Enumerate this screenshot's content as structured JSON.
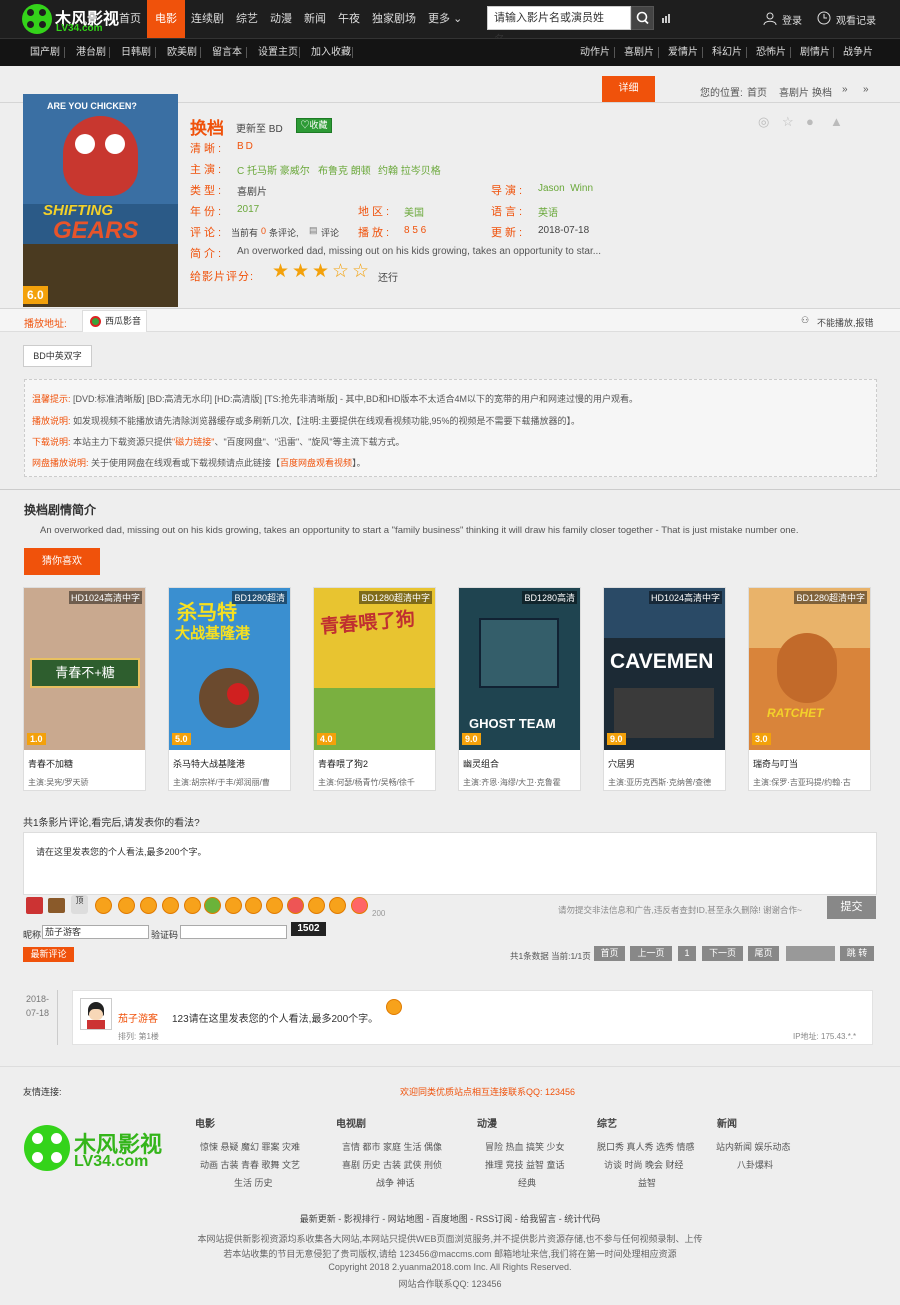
{
  "header": {
    "logo_text": "木风影视",
    "logo_url": "LV34.com",
    "nav": [
      "首页",
      "电影",
      "连续剧",
      "综艺",
      "动漫",
      "新闻",
      "午夜",
      "独家剧场",
      "更多"
    ],
    "search_placeholder": "请输入影片名或演员姓名。",
    "login": "登录",
    "history": "观看记录"
  },
  "subnav": {
    "left": [
      "国产剧",
      "港台剧",
      "日韩剧",
      "欧美剧",
      "留言本",
      "设置主页",
      "加入收藏"
    ],
    "right": [
      "动作片",
      "喜剧片",
      "爱情片",
      "科幻片",
      "恐怖片",
      "剧情片",
      "战争片"
    ]
  },
  "crumb": {
    "detail_btn": "详细",
    "location": "您的位置:",
    "home": "首页",
    "cat": "喜剧片",
    "title": "换档",
    "arrow1": "»",
    "arrow2": "»"
  },
  "movie": {
    "poster_top": "ARE YOU CHICKEN?",
    "poster_title1": "SHIFTING",
    "poster_title2": "GEARS",
    "score": "6.0",
    "title": "换档",
    "update": "更新至 BD",
    "fav": "收藏",
    "clarity_label": "清晰:",
    "clarity": "BD",
    "actors_label": "主演:",
    "actors": [
      "C 托马斯 豪威尔",
      "布鲁克 朗顿",
      "约翰 拉岑贝格"
    ],
    "type_label": "类型:",
    "type": "喜剧片",
    "director_label": "导演:",
    "director": "Jason  Winn",
    "year_label": "年份:",
    "year": "2017",
    "area_label": "地区:",
    "area": "美国",
    "lang_label": "语言:",
    "lang": "英语",
    "comment_label": "评论:",
    "comment_pre": "当前有",
    "comment_count": "0",
    "comment_post": "条评论,",
    "comment_link": "评论",
    "play_label": "播放:",
    "play_count": "8 5 6",
    "date_label": "更新:",
    "date": "2018-07-18",
    "intro_label": "简介:",
    "intro": "An overworked dad, missing out on his kids growing, takes an opportunity to star...",
    "rate_label": "给影片评分:",
    "rating": 3,
    "rate_text": "还行"
  },
  "play": {
    "label": "播放地址:",
    "source": "西瓜影音",
    "report": "不能播放,报错",
    "episode": "BD中英双字"
  },
  "notice": {
    "l1_label": "温馨提示:",
    "l1": "[DVD:标准清晰版] [BD:高清无水印] [HD:高清版] [TS:抢先非清晰版] - 其中,BD和HD版本不太适合4M以下的宽带的用户和网速过慢的用户观看。",
    "l2_label": "播放说明:",
    "l2": "如发现视频不能播放请先清除浏览器缓存或多刷新几次,【注明:主要提供在线观看视频功能,95%的视频是不需要下载播放器的】。",
    "l3_label": "下载说明:",
    "l3a": "本站主力下载资源只提供",
    "l3b": "\"磁力链接\"",
    "l3c": "、\"百度网盘\"、\"迅雷\"、\"旋风\"等主流下载方式。",
    "l4_label": "网盘播放说明:",
    "l4a": "关于使用网盘在线观看或下载视频请点此链接【",
    "l4b": "百度网盘观看视频",
    "l4c": "】。"
  },
  "synopsis": {
    "title": "换档剧情简介",
    "text": "An overworked dad, missing out on his kids growing, takes an opportunity to start a \"family business\" thinking it will draw his family closer together - That is just mistake number one."
  },
  "guess": {
    "label": "猜你喜欢",
    "items": [
      {
        "name": "青春不加糖",
        "actors": "主演:吴宪/罗天骄",
        "q": "HD1024高清中字",
        "score": "1.0",
        "color": "#c9a98f"
      },
      {
        "name": "杀马特大战基隆港",
        "actors": "主演:胡宗祥/于丰/郑润丽/曹",
        "q": "BD1280超清",
        "score": "5.0",
        "color": "#3a8fd0"
      },
      {
        "name": "青春喂了狗2",
        "actors": "主演:何瑟/杨青竹/吴畅/徐千",
        "q": "BD1280超清中字",
        "score": "4.0",
        "color": "#e8c430"
      },
      {
        "name": "幽灵组合",
        "actors": "主演:齐恩·海缪/大卫·克鲁霍",
        "q": "BD1280高清",
        "score": "9.0",
        "color": "#1f4450"
      },
      {
        "name": "穴居男",
        "actors": "主演:亚历克西斯·克纳普/查德",
        "q": "HD1024高清中字",
        "score": "9.0",
        "color": "#1c2a35"
      },
      {
        "name": "瑞奇与叮当",
        "actors": "主演:保罗·吉亚玛提/约翰·古",
        "q": "BD1280超清中字",
        "score": "3.0",
        "color": "#d9843a"
      }
    ]
  },
  "comment": {
    "title": "共1条影片评论,看完后,请发表你的看法?",
    "placeholder": "请在这里发表您的个人看法,最多200个字。",
    "count": "200",
    "warn": "请勿提交非法信息和广告,违反者查封ID,甚至永久删除! 谢谢合作~",
    "submit": "提交",
    "nick_label": "昵称",
    "nick": "茄子游客",
    "code_label": "验证码",
    "code": "1502",
    "latest": "最新评论",
    "pager_info": "共1条数据 当前:1/1页",
    "pages": [
      "首页",
      "上一页",
      "1",
      "下一页",
      "尾页"
    ],
    "jump": "跳 转",
    "item": {
      "date1": "2018-",
      "date2": "07-18",
      "user": "茄子游客",
      "text": "123请在这里发表您的个人看法,最多200个字。",
      "ip": "IP地址: 175.43.*.*",
      "rank": "排列: 第1楼"
    }
  },
  "footer": {
    "links_label": "友情连接:",
    "links_ad": "欢迎同类优质站点相互连接联系QQ: 123456",
    "cols": [
      {
        "title": "电影",
        "rows": [
          "惊悚 悬疑 魔幻 罪案 灾难",
          "动画 古装 青春 歌舞 文艺",
          "生活 历史"
        ]
      },
      {
        "title": "电视剧",
        "rows": [
          "言情 都市 家庭 生活 偶像",
          "喜剧 历史 古装 武侠 刑侦",
          "战争 神话"
        ]
      },
      {
        "title": "动漫",
        "rows": [
          "冒险 热血 搞笑 少女",
          "推理 竞技 益智 童话",
          "经典"
        ]
      },
      {
        "title": "综艺",
        "rows": [
          "脱口秀 真人秀 选秀 情感",
          "访谈 时尚 晚会 财经",
          "益智"
        ]
      },
      {
        "title": "新闻",
        "rows": [
          "站内新闻 娱乐动态",
          "八卦爆料"
        ]
      }
    ],
    "bar": "最新更新 - 影视排行 - 网站地图 - 百度地图 - RSS订阅 - 给我留言 - 统计代码",
    "c1": "本网站提供新影视资源均系收集各大网站,本网站只提供WEB页面浏览服务,并不提供影片资源存储,也不参与任何视频录制、上传",
    "c2": "若本站收集的节目无意侵犯了贵司版权,请给 123456@maccms.com 邮箱地址来信,我们将在第一时间处理相应资源",
    "c3": "Copyright 2018 2.yuanma2018.com Inc. All Rights Reserved.",
    "c4": "网站合作联系QQ: 123456"
  }
}
